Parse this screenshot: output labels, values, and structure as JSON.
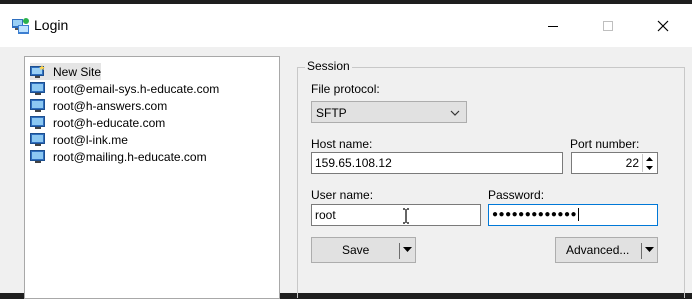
{
  "window": {
    "title": "Login"
  },
  "site_list": {
    "items": [
      {
        "label": "New Site",
        "selected": true
      },
      {
        "label": "root@email-sys.h-educate.com",
        "selected": false
      },
      {
        "label": "root@h-answers.com",
        "selected": false
      },
      {
        "label": "root@h-educate.com",
        "selected": false
      },
      {
        "label": "root@l-ink.me",
        "selected": false
      },
      {
        "label": "root@mailing.h-educate.com",
        "selected": false
      }
    ]
  },
  "session": {
    "legend": "Session",
    "file_protocol_label": "File protocol:",
    "file_protocol_value": "SFTP",
    "host_label": "Host name:",
    "host_value": "159.65.108.12",
    "port_label": "Port number:",
    "port_value": "22",
    "user_label": "User name:",
    "user_value": "root",
    "password_label": "Password:",
    "password_value": "●●●●●●●●●●●●●"
  },
  "buttons": {
    "save": "Save",
    "advanced": "Advanced..."
  },
  "icons": {
    "app": "winscp-login-icon",
    "new_site": "new-site-icon",
    "site": "monitor-icon",
    "minimize": "minimize-icon",
    "maximize": "maximize-icon",
    "close": "close-icon",
    "dropdown": "chevron-down-icon",
    "split": "triangle-down-icon",
    "spin": "spinner-icon",
    "cursor": "text-cursor-icon"
  }
}
